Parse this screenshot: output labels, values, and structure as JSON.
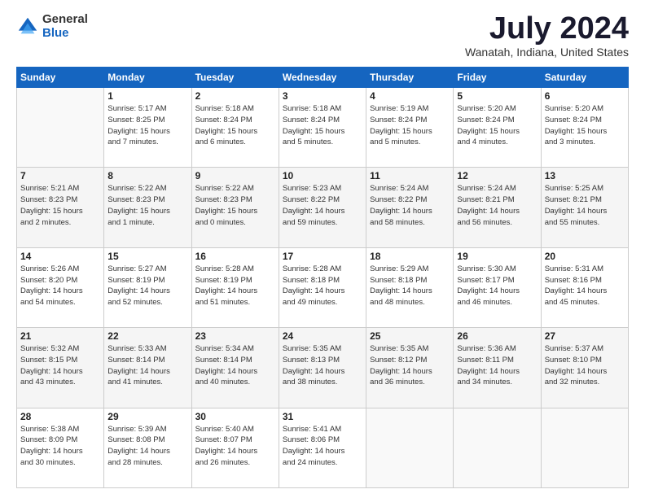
{
  "logo": {
    "general": "General",
    "blue": "Blue"
  },
  "title": "July 2024",
  "location": "Wanatah, Indiana, United States",
  "days_of_week": [
    "Sunday",
    "Monday",
    "Tuesday",
    "Wednesday",
    "Thursday",
    "Friday",
    "Saturday"
  ],
  "weeks": [
    [
      {
        "day": "",
        "info": ""
      },
      {
        "day": "1",
        "info": "Sunrise: 5:17 AM\nSunset: 8:25 PM\nDaylight: 15 hours\nand 7 minutes."
      },
      {
        "day": "2",
        "info": "Sunrise: 5:18 AM\nSunset: 8:24 PM\nDaylight: 15 hours\nand 6 minutes."
      },
      {
        "day": "3",
        "info": "Sunrise: 5:18 AM\nSunset: 8:24 PM\nDaylight: 15 hours\nand 5 minutes."
      },
      {
        "day": "4",
        "info": "Sunrise: 5:19 AM\nSunset: 8:24 PM\nDaylight: 15 hours\nand 5 minutes."
      },
      {
        "day": "5",
        "info": "Sunrise: 5:20 AM\nSunset: 8:24 PM\nDaylight: 15 hours\nand 4 minutes."
      },
      {
        "day": "6",
        "info": "Sunrise: 5:20 AM\nSunset: 8:24 PM\nDaylight: 15 hours\nand 3 minutes."
      }
    ],
    [
      {
        "day": "7",
        "info": "Sunrise: 5:21 AM\nSunset: 8:23 PM\nDaylight: 15 hours\nand 2 minutes."
      },
      {
        "day": "8",
        "info": "Sunrise: 5:22 AM\nSunset: 8:23 PM\nDaylight: 15 hours\nand 1 minute."
      },
      {
        "day": "9",
        "info": "Sunrise: 5:22 AM\nSunset: 8:23 PM\nDaylight: 15 hours\nand 0 minutes."
      },
      {
        "day": "10",
        "info": "Sunrise: 5:23 AM\nSunset: 8:22 PM\nDaylight: 14 hours\nand 59 minutes."
      },
      {
        "day": "11",
        "info": "Sunrise: 5:24 AM\nSunset: 8:22 PM\nDaylight: 14 hours\nand 58 minutes."
      },
      {
        "day": "12",
        "info": "Sunrise: 5:24 AM\nSunset: 8:21 PM\nDaylight: 14 hours\nand 56 minutes."
      },
      {
        "day": "13",
        "info": "Sunrise: 5:25 AM\nSunset: 8:21 PM\nDaylight: 14 hours\nand 55 minutes."
      }
    ],
    [
      {
        "day": "14",
        "info": "Sunrise: 5:26 AM\nSunset: 8:20 PM\nDaylight: 14 hours\nand 54 minutes."
      },
      {
        "day": "15",
        "info": "Sunrise: 5:27 AM\nSunset: 8:19 PM\nDaylight: 14 hours\nand 52 minutes."
      },
      {
        "day": "16",
        "info": "Sunrise: 5:28 AM\nSunset: 8:19 PM\nDaylight: 14 hours\nand 51 minutes."
      },
      {
        "day": "17",
        "info": "Sunrise: 5:28 AM\nSunset: 8:18 PM\nDaylight: 14 hours\nand 49 minutes."
      },
      {
        "day": "18",
        "info": "Sunrise: 5:29 AM\nSunset: 8:18 PM\nDaylight: 14 hours\nand 48 minutes."
      },
      {
        "day": "19",
        "info": "Sunrise: 5:30 AM\nSunset: 8:17 PM\nDaylight: 14 hours\nand 46 minutes."
      },
      {
        "day": "20",
        "info": "Sunrise: 5:31 AM\nSunset: 8:16 PM\nDaylight: 14 hours\nand 45 minutes."
      }
    ],
    [
      {
        "day": "21",
        "info": "Sunrise: 5:32 AM\nSunset: 8:15 PM\nDaylight: 14 hours\nand 43 minutes."
      },
      {
        "day": "22",
        "info": "Sunrise: 5:33 AM\nSunset: 8:14 PM\nDaylight: 14 hours\nand 41 minutes."
      },
      {
        "day": "23",
        "info": "Sunrise: 5:34 AM\nSunset: 8:14 PM\nDaylight: 14 hours\nand 40 minutes."
      },
      {
        "day": "24",
        "info": "Sunrise: 5:35 AM\nSunset: 8:13 PM\nDaylight: 14 hours\nand 38 minutes."
      },
      {
        "day": "25",
        "info": "Sunrise: 5:35 AM\nSunset: 8:12 PM\nDaylight: 14 hours\nand 36 minutes."
      },
      {
        "day": "26",
        "info": "Sunrise: 5:36 AM\nSunset: 8:11 PM\nDaylight: 14 hours\nand 34 minutes."
      },
      {
        "day": "27",
        "info": "Sunrise: 5:37 AM\nSunset: 8:10 PM\nDaylight: 14 hours\nand 32 minutes."
      }
    ],
    [
      {
        "day": "28",
        "info": "Sunrise: 5:38 AM\nSunset: 8:09 PM\nDaylight: 14 hours\nand 30 minutes."
      },
      {
        "day": "29",
        "info": "Sunrise: 5:39 AM\nSunset: 8:08 PM\nDaylight: 14 hours\nand 28 minutes."
      },
      {
        "day": "30",
        "info": "Sunrise: 5:40 AM\nSunset: 8:07 PM\nDaylight: 14 hours\nand 26 minutes."
      },
      {
        "day": "31",
        "info": "Sunrise: 5:41 AM\nSunset: 8:06 PM\nDaylight: 14 hours\nand 24 minutes."
      },
      {
        "day": "",
        "info": ""
      },
      {
        "day": "",
        "info": ""
      },
      {
        "day": "",
        "info": ""
      }
    ]
  ]
}
